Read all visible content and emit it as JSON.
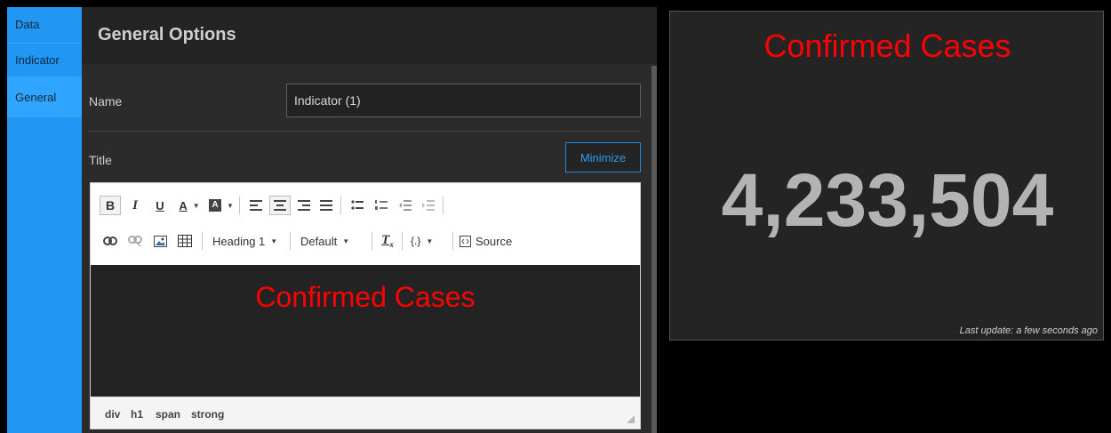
{
  "sidebar": {
    "tabs": [
      {
        "label": "Data"
      },
      {
        "label": "Indicator"
      },
      {
        "label": "General"
      }
    ],
    "active_tab": "General"
  },
  "panel": {
    "title": "General Options",
    "name_label": "Name",
    "name_value": "Indicator (1)",
    "title_label": "Title",
    "minimize_label": "Minimize"
  },
  "editor": {
    "toolbar": {
      "bold": "B",
      "italic": "I",
      "underline": "U",
      "heading_select": "Heading 1",
      "font_select": "Default",
      "code_select": "{.}",
      "source_label": "Source"
    },
    "content_heading": "Confirmed Cases",
    "content_color": "#ff0000",
    "elements_path": [
      "div",
      "h1",
      "span",
      "strong"
    ]
  },
  "preview": {
    "title": "Confirmed Cases",
    "value": "4,233,504",
    "footer": "Last update: a few seconds ago"
  },
  "colors": {
    "accent": "#2196f3",
    "title_red": "#ff0000",
    "panel_bg": "#2b2b2b",
    "card_bg": "#242424"
  }
}
